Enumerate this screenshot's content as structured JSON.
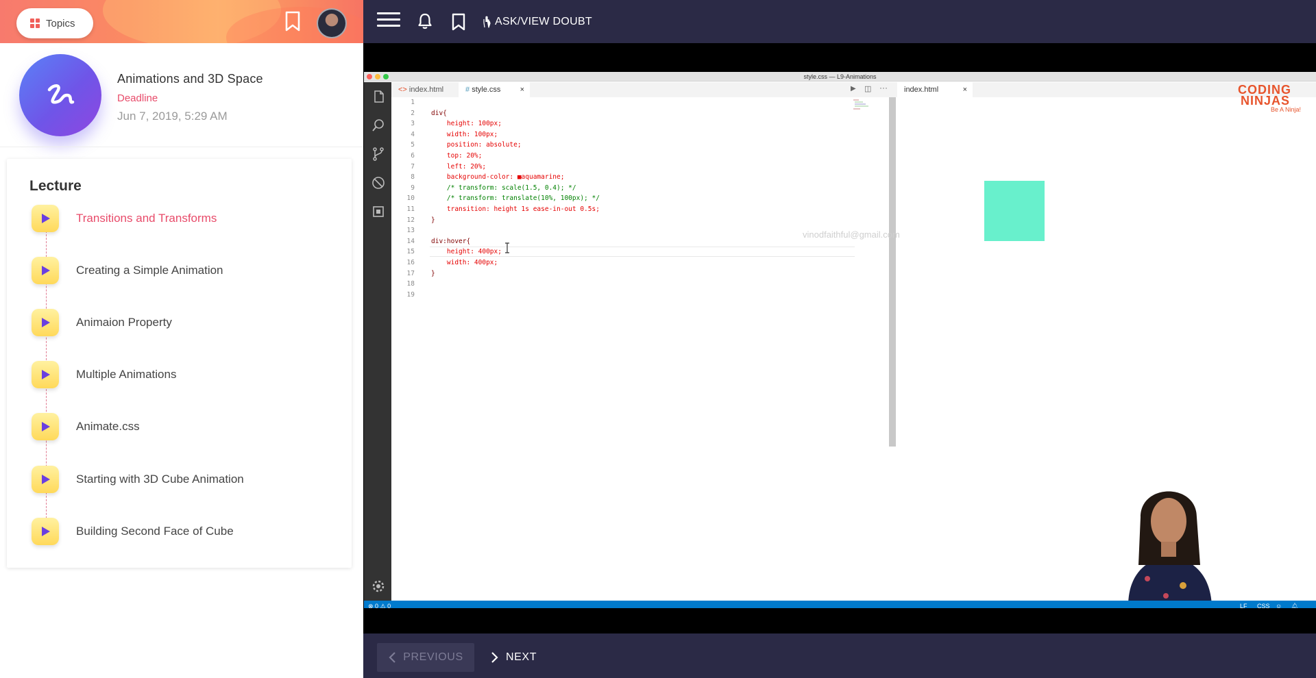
{
  "left_header": {
    "topics_label": "Topics",
    "accent_color": "#f0605b"
  },
  "course": {
    "title": "Animations and 3D Space",
    "deadline_label": "Deadline",
    "deadline_date": "Jun 7, 2019, 5:29 AM"
  },
  "lecture": {
    "heading": "Lecture",
    "items": [
      {
        "label": "Transitions and Transforms",
        "active": true
      },
      {
        "label": "Creating a Simple Animation",
        "active": false
      },
      {
        "label": "Animaion Property",
        "active": false
      },
      {
        "label": "Multiple Animations",
        "active": false
      },
      {
        "label": "Animate.css",
        "active": false
      },
      {
        "label": "Starting with 3D Cube Animation",
        "active": false
      },
      {
        "label": "Building Second Face of Cube",
        "active": false
      }
    ]
  },
  "topbar": {
    "doubt_label": "ASK/VIEW DOUBT"
  },
  "video": {
    "window_title": "style.css — L9-Animations",
    "tabs": [
      "index.html",
      "style.css"
    ],
    "preview_tab": "index.html",
    "watermark": "vinodfaithful@gmail.com",
    "code_lines": [
      {
        "n": "1",
        "text": ""
      },
      {
        "n": "2",
        "text": "div{"
      },
      {
        "n": "3",
        "text": "    height: 100px;"
      },
      {
        "n": "4",
        "text": "    width: 100px;"
      },
      {
        "n": "5",
        "text": "    position: absolute;"
      },
      {
        "n": "6",
        "text": "    top: 20%;"
      },
      {
        "n": "7",
        "text": "    left: 20%;"
      },
      {
        "n": "8",
        "text": "    background-color: ■aquamarine;"
      },
      {
        "n": "9",
        "text": "    /* transform: scale(1.5, 0.4); */"
      },
      {
        "n": "10",
        "text": "    /* transform: translate(10%, 100px); */"
      },
      {
        "n": "11",
        "text": "    transition: height 1s ease-in-out 0.5s;"
      },
      {
        "n": "12",
        "text": "}"
      },
      {
        "n": "13",
        "text": ""
      },
      {
        "n": "14",
        "text": "div:hover{"
      },
      {
        "n": "15",
        "text": "    height: 400px;"
      },
      {
        "n": "16",
        "text": "    width: 400px;"
      },
      {
        "n": "17",
        "text": "}"
      },
      {
        "n": "18",
        "text": ""
      },
      {
        "n": "19",
        "text": ""
      }
    ],
    "status": {
      "errors": "0",
      "warnings": "0",
      "eol": "LF",
      "lang": "CSS"
    },
    "preview_box_color": "#68f0cc",
    "logo_text_1": "CODING",
    "logo_text_2": "NINJAS",
    "logo_tagline": "Be A Ninja!"
  },
  "nav": {
    "previous_label": "PREVIOUS",
    "next_label": "NEXT"
  }
}
